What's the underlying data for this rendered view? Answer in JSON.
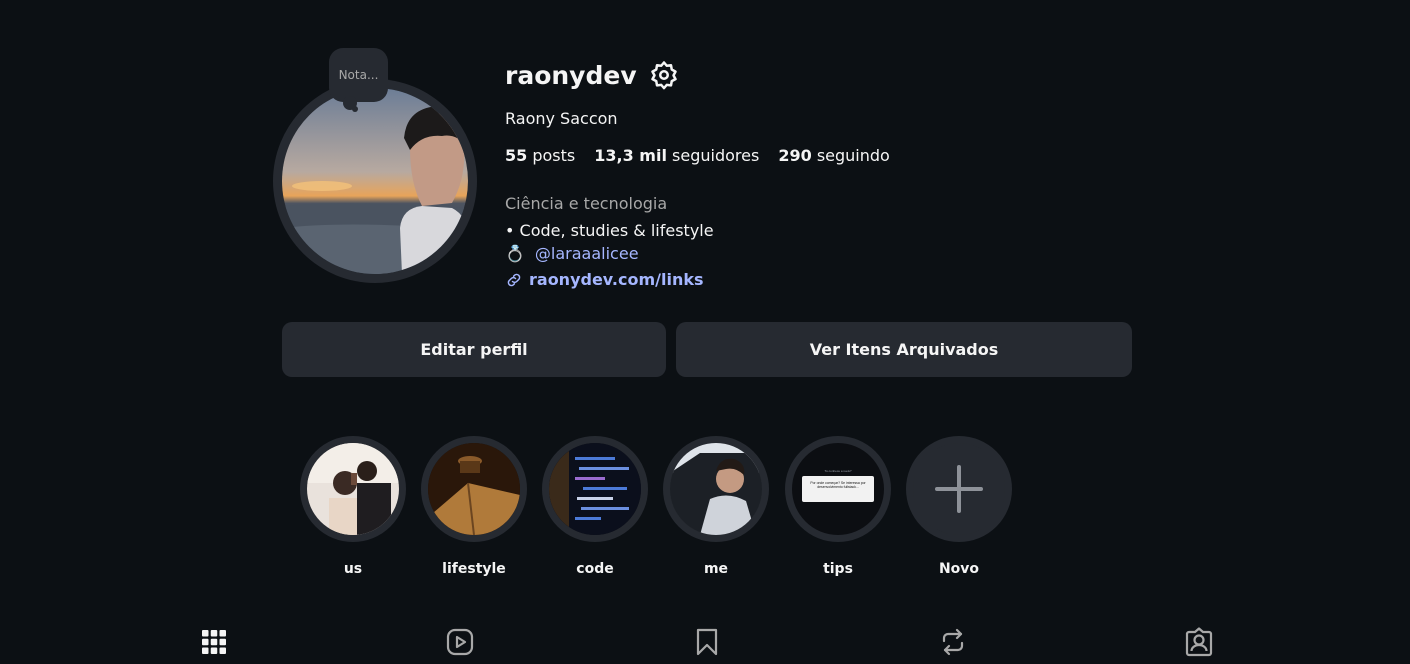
{
  "profile": {
    "username": "raonydev",
    "full_name": "Raony Saccon",
    "note": "Nota...",
    "stats": {
      "posts_value": "55",
      "posts_label": "posts",
      "followers_value": "13,3 mil",
      "followers_label": "seguidores",
      "following_value": "290",
      "following_label": "seguindo"
    },
    "category": "Ciência e tecnologia",
    "bio_line": "• Code, studies & lifestyle",
    "mention_emoji": "💍",
    "mention": "@laraaalicee",
    "link": "raonydev.com/links"
  },
  "actions": {
    "edit_profile": "Editar perfil",
    "view_archive": "Ver Itens Arquivados"
  },
  "highlights": [
    {
      "label": "us"
    },
    {
      "label": "lifestyle"
    },
    {
      "label": "code"
    },
    {
      "label": "me"
    },
    {
      "label": "tips",
      "card_title": "Tu conhece a reels?",
      "card_text": "Por onde começar? Se interessa por desenvolvimento fullstack..."
    },
    {
      "label": "Novo"
    }
  ],
  "tabs": [
    {
      "icon": "grid-icon"
    },
    {
      "icon": "reels-icon"
    },
    {
      "icon": "saved-icon"
    },
    {
      "icon": "reposts-icon"
    },
    {
      "icon": "tagged-icon"
    }
  ],
  "colors": {
    "background": "#0c1014",
    "surface": "#262a31",
    "text": "#f5f5f5",
    "muted": "#a8a8a8",
    "link": "#a5b6ff"
  }
}
